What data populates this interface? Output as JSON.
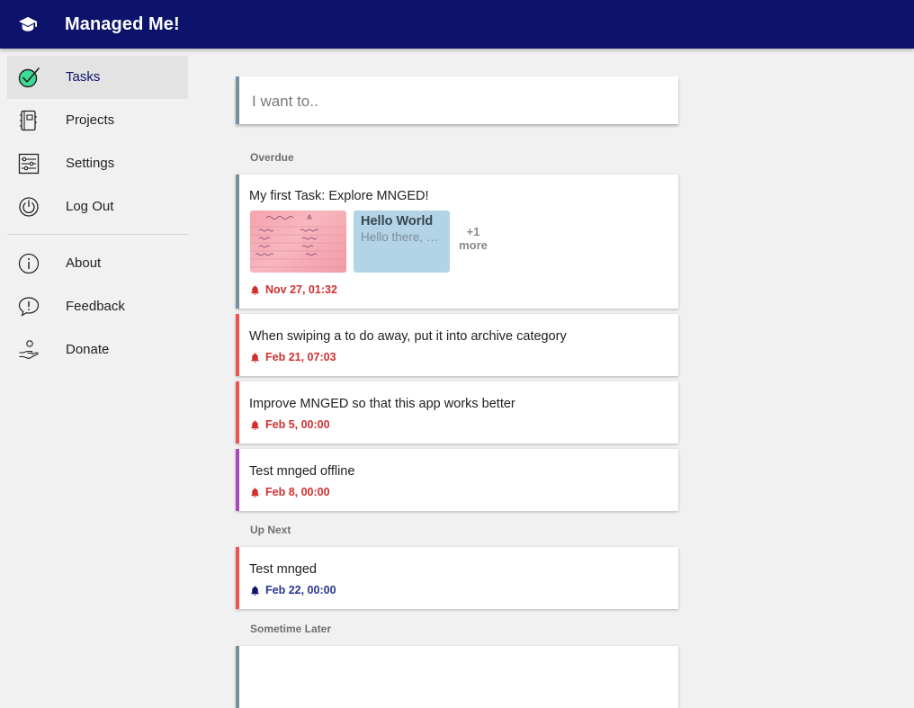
{
  "app": {
    "title": "Managed Me!",
    "logo_icon": "graduation-cap-icon"
  },
  "sidebar": {
    "items": [
      {
        "label": "Tasks",
        "icon": "check-circle-icon",
        "active": true
      },
      {
        "label": "Projects",
        "icon": "notebook-icon"
      },
      {
        "label": "Settings",
        "icon": "sliders-icon"
      },
      {
        "label": "Log Out",
        "icon": "power-icon"
      },
      {
        "label": "About",
        "icon": "info-icon"
      },
      {
        "label": "Feedback",
        "icon": "feedback-bubble-icon"
      },
      {
        "label": "Donate",
        "icon": "donate-hand-icon"
      }
    ]
  },
  "search": {
    "placeholder": "I want to.."
  },
  "sections": {
    "overdue": "Overdue",
    "up_next": "Up Next",
    "sometime_later": "Sometime Later"
  },
  "tasks": {
    "overdue": [
      {
        "title": "My first Task: Explore MNGED!",
        "due": "Nov 27, 01:32",
        "accent": "#78909c",
        "note": {
          "title": "Hello World",
          "body": "Hello there, …"
        },
        "more_count": "+1",
        "more_label": "more"
      },
      {
        "title": "When swiping a to do away, put it into archive category",
        "due": "Feb 21, 07:03",
        "accent": "#ef5350"
      },
      {
        "title": "Improve MNGED so that this app works better",
        "due": "Feb 5, 00:00",
        "accent": "#ef5350"
      },
      {
        "title": "Test mnged offline",
        "due": "Feb 8, 00:00",
        "accent": "#ab47bc"
      }
    ],
    "up_next": [
      {
        "title": "Test mnged",
        "due": "Feb 22, 00:00",
        "accent": "#ef5350"
      }
    ]
  },
  "colors": {
    "appbar": "#0d136b",
    "overdue_date": "#d32f2f",
    "upcoming_date": "#283593",
    "background": "#f1f1f1"
  }
}
